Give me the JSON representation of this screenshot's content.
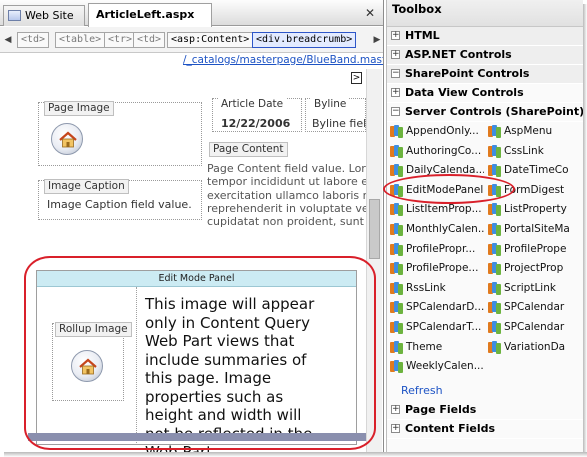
{
  "tabs": [
    {
      "label": "Web Site"
    },
    {
      "label": "ArticleLeft.aspx"
    }
  ],
  "tab_close_glyph": "✕",
  "breadcrumbs": [
    "<td>",
    "<table>",
    "<tr>",
    "<td>",
    "<asp:Content>",
    "<div.breadcrumb>"
  ],
  "url_path": "/_catalogs/masterpage/BlueBand.master",
  "design": {
    "page_image_label": "Page Image",
    "article_date_label": "Article Date",
    "article_date_value": "12/22/2006",
    "byline_label": "Byline",
    "byline_value": "Byline field",
    "page_content_label": "Page Content",
    "page_content_lines": [
      "Page Content field value. Lor",
      "tempor incididunt ut labore e",
      "exercitation ullamco laboris n",
      "reprehenderit in voluptate ve",
      "cupidatat non proident, sunt"
    ],
    "image_caption_label": "Image Caption",
    "image_caption_value": "Image Caption field value.",
    "edit_mode_panel_title": "Edit Mode Panel",
    "rollup_image_label": "Rollup Image",
    "edit_mode_lines": [
      "This image will appear",
      "only in Content Query",
      "Web Part views that",
      "include summaries of",
      "this page. Image",
      "properties such as",
      "height and width will",
      "not be reflected in the",
      "Web Part."
    ]
  },
  "toolbox": {
    "title": "Toolbox",
    "categories_top": [
      {
        "label": "HTML",
        "expander": "+"
      },
      {
        "label": "ASP.NET Controls",
        "expander": "+"
      },
      {
        "label": "SharePoint Controls",
        "expander": "−"
      }
    ],
    "subcategories": [
      {
        "label": "Data View Controls",
        "expander": "+"
      },
      {
        "label": "Server Controls (SharePoint)",
        "expander": "−"
      }
    ],
    "items": [
      [
        "AppendOnly...",
        "AspMenu"
      ],
      [
        "AuthoringCo...",
        "CssLink"
      ],
      [
        "DailyCalenda...",
        "DateTimeCo"
      ],
      [
        "EditModePanel",
        "FormDigest"
      ],
      [
        "ListItemProp...",
        "ListProperty"
      ],
      [
        "MonthlyCalen...",
        "PortalSiteMa"
      ],
      [
        "ProfilePropr...",
        "ProfilePrope"
      ],
      [
        "ProfilePrope...",
        "ProjectProp"
      ],
      [
        "RssLink",
        "ScriptLink"
      ],
      [
        "SPCalendarD...",
        "SPCalendar"
      ],
      [
        "SPCalendarT...",
        "SPCalendar"
      ],
      [
        "Theme",
        "VariationDa"
      ],
      [
        "WeeklyCalen...",
        ""
      ]
    ],
    "refresh_label": "Refresh",
    "categories_bottom": [
      {
        "label": "Page Fields",
        "expander": "+"
      },
      {
        "label": "Content Fields",
        "expander": "+"
      }
    ]
  },
  "colors": {
    "highlight_ring": "#d9202a",
    "edit_panel_title_bg": "#ccebf3",
    "link_blue": "#1d53c4"
  }
}
